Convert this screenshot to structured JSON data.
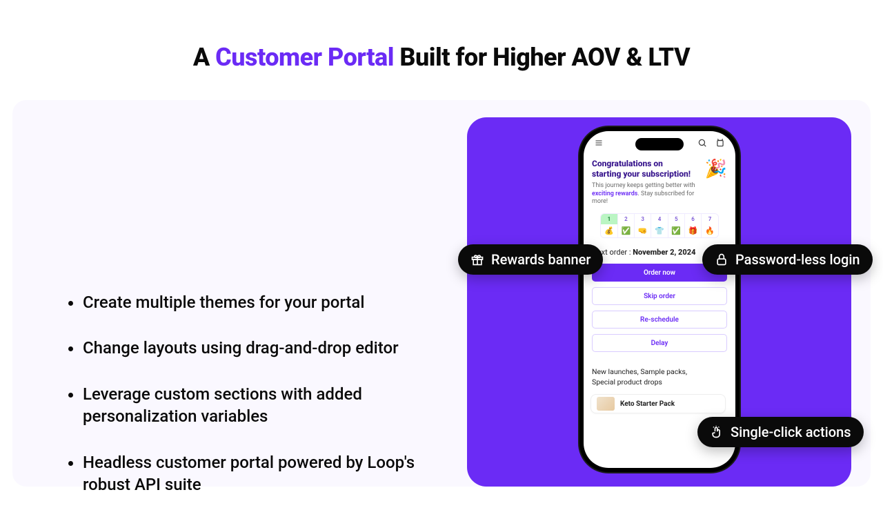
{
  "headline": {
    "prefix": "A ",
    "accent": "Customer Portal",
    "suffix": " Built for Higher AOV & LTV"
  },
  "bullets": [
    "Create multiple themes for your portal",
    "Change layouts using drag-and-drop editor",
    "Leverage custom sections with added personalization variables",
    "Headless customer portal powered by Loop's robust API suite"
  ],
  "pills": {
    "rewards": "Rewards banner",
    "password": "Password-less login",
    "single": "Single-click actions"
  },
  "phone": {
    "congr_line1": "Congratulations on",
    "congr_line2": "starting your subscription!",
    "sub_plain1": "This journey keeps getting better with",
    "sub_hl": "exciting rewards",
    "sub_plain2": ". Stay subscribed for more!",
    "reward_nums": [
      "1",
      "2",
      "3",
      "4",
      "5",
      "6",
      "7"
    ],
    "reward_glyphs": [
      "💰",
      "✅",
      "🤜",
      "👕",
      "✅",
      "🎁",
      "🔥"
    ],
    "next_order_label": "Next order : ",
    "next_order_date": "November 2, 2024",
    "buttons": {
      "order": "Order now",
      "skip": "Skip order",
      "resched": "Re-schedule",
      "delay": "Delay"
    },
    "launches_line1": "New launches, Sample packs,",
    "launches_line2": "Special product drops",
    "starter": "Keto Starter Pack"
  }
}
